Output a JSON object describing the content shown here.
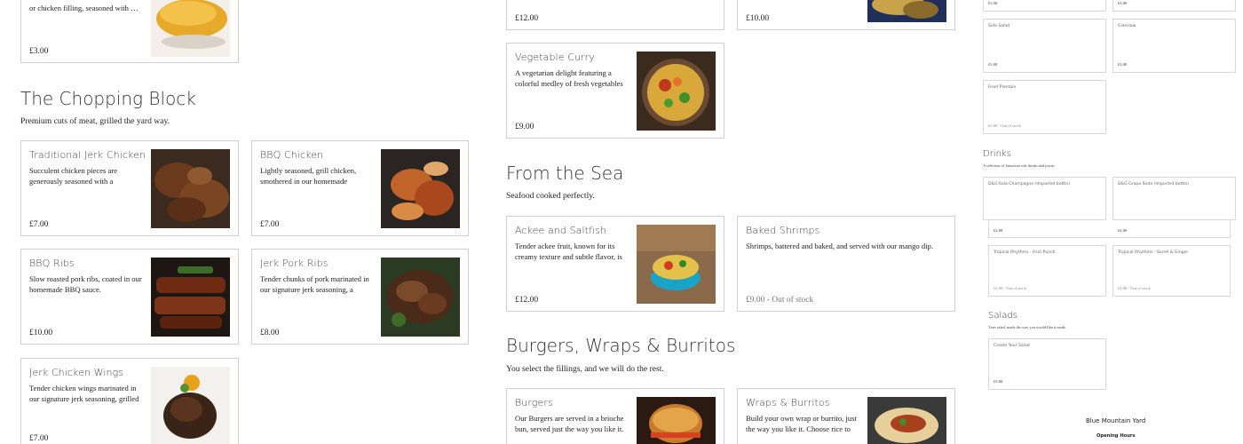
{
  "top_partial": {
    "desc": "or chicken filling, seasoned with …",
    "price": "£3.00"
  },
  "top_mid": [
    {
      "price": "£12.00"
    },
    {
      "price": "£10.00"
    }
  ],
  "chopping_block": {
    "title": "The Chopping Block",
    "subtitle": "Premium cuts of meat, grilled the yard way.",
    "items": [
      {
        "title": "Traditional Jerk Chicken",
        "desc": "Succulent chicken pieces are generously seasoned with a tantalizi…",
        "price": "£7.00",
        "image": "jerk-chicken-photo"
      },
      {
        "title": "BBQ Chicken",
        "desc": "Lightly seasoned, grill chicken, smothered in our homemade molass…",
        "price": "£7.00",
        "image": "bbq-chicken-photo"
      },
      {
        "title": "BBQ Ribs",
        "desc": "Slow roasted pork ribs, coated in our homemade BBQ sauce.",
        "price": "£10.00",
        "image": "bbq-ribs-photo"
      },
      {
        "title": "Jerk Pork Ribs",
        "desc": "Tender chunks of pork marinated in our signature jerk seasoning, a blend…",
        "price": "£8.00",
        "image": "jerk-pork-photo"
      },
      {
        "title": "Jerk Chicken Wings",
        "desc": "Tender chicken wings marinated in our signature jerk seasoning, grilled to …",
        "price": "£7.00",
        "image": "chicken-wings-photo"
      }
    ]
  },
  "vegetable_curry": {
    "title": "Vegetable Curry",
    "desc": "A vegetarian delight featuring a colorful medley of fresh vegetables …",
    "price": "£9.00",
    "image": "vegetable-curry-photo"
  },
  "sea": {
    "title": "From the Sea",
    "subtitle": "Seafood cooked perfectly.",
    "items": [
      {
        "title": "Ackee and Saltfish",
        "desc": "Tender ackee fruit, known for its creamy texture and subtle flavor, is …",
        "price": "£12.00",
        "image": "ackee-saltfish-photo"
      },
      {
        "title": "Baked Shrimps",
        "desc": "Shrimps, battered and baked, and served with our mango dip.",
        "price": "£9.00 - Out of stock"
      }
    ]
  },
  "burgers": {
    "title": "Burgers, Wraps & Burritos",
    "subtitle": "You select the fillings, and we will do the rest.",
    "items": [
      {
        "title": "Burgers",
        "desc": "Our Burgers are served in a brioche bun, served just the way you like it. …",
        "image": "burger-photo"
      },
      {
        "title": "Wraps & Burritos",
        "desc": "Build your own wrap or burrito, just the way you like it. Choose rice to st…",
        "image": "burrito-photo"
      }
    ]
  },
  "sidebar": {
    "top_prices": [
      "£3.50",
      "£3.00"
    ],
    "sides": [
      {
        "title": "Side Salad",
        "price": "£3.00"
      },
      {
        "title": "Coleslaw",
        "price": "£3.00"
      },
      {
        "title": "Fried Plantain",
        "price": "£3.00 - Out of stock"
      }
    ],
    "drinks": {
      "title": "Drinks",
      "subtitle": "A selection of Jamaican soft drinks and juices.",
      "items": [
        {
          "title": "D&G Kola Champagne (Imported bottle)",
          "price": "£2.00"
        },
        {
          "title": "D&G Grape Soda (Imported bottle)",
          "price": "£2.00"
        },
        {
          "title": "Tropical Rhythms - Fruit Punch",
          "price": "£4.00 - Out of stock"
        },
        {
          "title": "Tropical Rhythms - Sorrel & Ginger",
          "price": "£4.00 - Out of stock"
        }
      ]
    },
    "salads": {
      "title": "Salads",
      "subtitle": "Your salad, made the way you would like it made.",
      "items": [
        {
          "title": "Create Your Salad",
          "price": "£5.00"
        }
      ]
    },
    "footer": {
      "name": "Blue Mountain Yard",
      "hours": "Opening Hours"
    }
  }
}
